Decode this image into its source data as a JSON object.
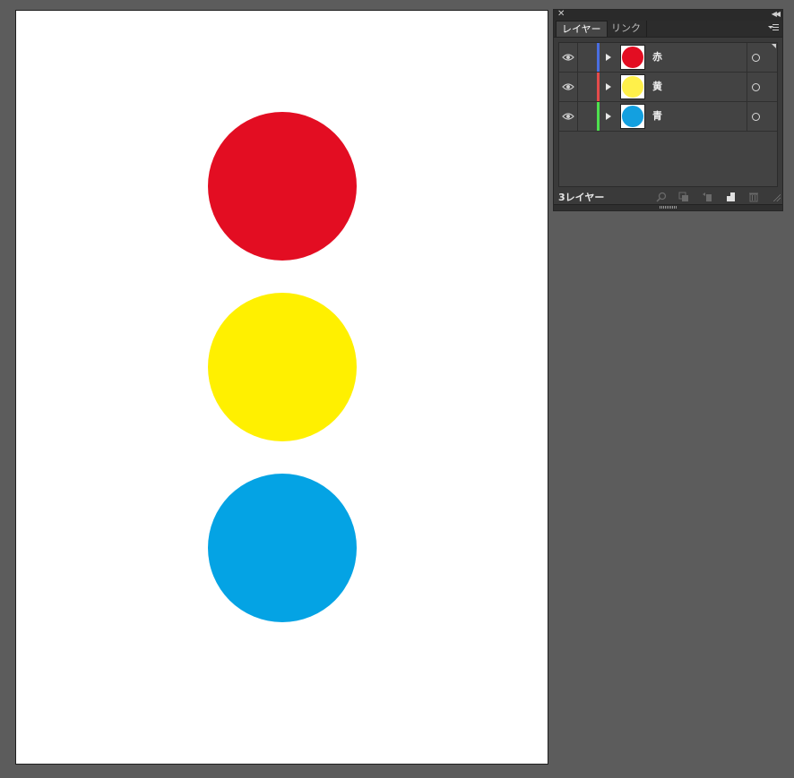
{
  "artboard": {
    "circles": [
      {
        "name": "red",
        "color": "#e30d22"
      },
      {
        "name": "yellow",
        "color": "#fff000"
      },
      {
        "name": "blue",
        "color": "#04a3e4"
      }
    ]
  },
  "panel": {
    "tabs": [
      {
        "label": "レイヤー",
        "active": true
      },
      {
        "label": "リンク",
        "active": false
      }
    ],
    "layers": [
      {
        "name": "赤",
        "bar_color": "#4a6ee0",
        "thumb_color": "#e30d22"
      },
      {
        "name": "黄",
        "bar_color": "#e34b4b",
        "thumb_color": "#fff04a"
      },
      {
        "name": "青",
        "bar_color": "#4ee04e",
        "thumb_color": "#13a0e0"
      }
    ],
    "layer_count": "3レイヤー",
    "icons": [
      "close-icon",
      "collapse-icon",
      "panel-menu-icon",
      "eye-icon",
      "expand-arrow-icon",
      "target-icon",
      "locate-object-icon",
      "clipping-mask-icon",
      "new-sublayer-icon",
      "new-layer-icon",
      "trash-icon"
    ]
  }
}
